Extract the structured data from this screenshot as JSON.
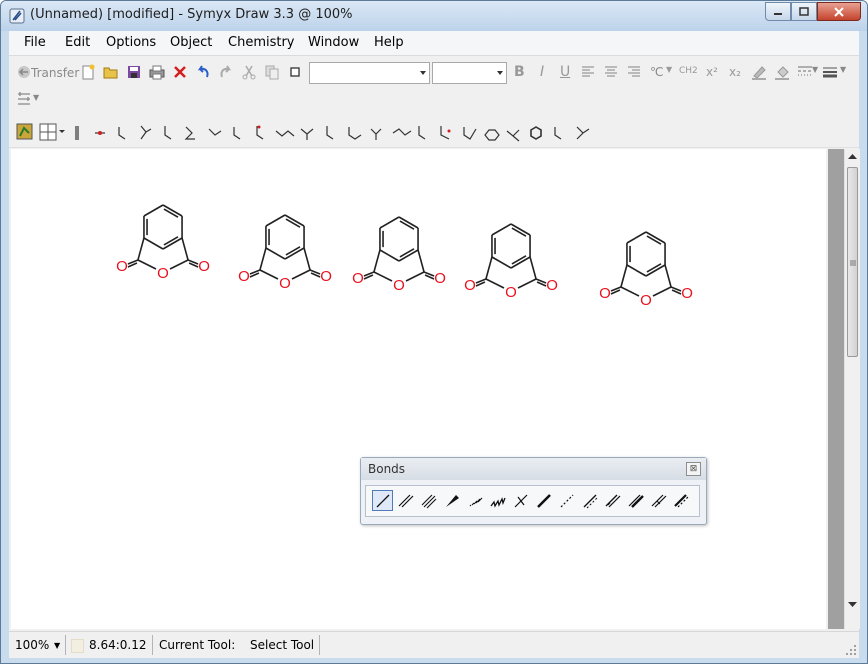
{
  "window": {
    "title": "(Unnamed) [modified] - Symyx Draw 3.3  @ 100%"
  },
  "menubar": {
    "items": [
      "File",
      "Edit",
      "Options",
      "Object",
      "Chemistry",
      "Window",
      "Help"
    ]
  },
  "toolbar": {
    "transfer_label": "Transfer",
    "font_combo_value": "",
    "size_combo_value": "",
    "bold_label": "B",
    "italic_label": "I",
    "underline_label": "U",
    "celsius_label": "℃",
    "ch2_label": "CH2",
    "superscript_label": "x²",
    "subscript_label": "x₂"
  },
  "molecules": [
    {
      "name": "phthalic-anhydride-1",
      "atoms": [
        "O",
        "O",
        "O"
      ]
    },
    {
      "name": "phthalic-anhydride-2",
      "atoms": [
        "O",
        "O",
        "O"
      ]
    },
    {
      "name": "phthalic-anhydride-3",
      "atoms": [
        "O",
        "O",
        "O"
      ]
    },
    {
      "name": "phthalic-anhydride-4",
      "atoms": [
        "O",
        "O",
        "O"
      ]
    },
    {
      "name": "phthalic-anhydride-5",
      "atoms": [
        "O",
        "O",
        "O"
      ]
    }
  ],
  "atom_color": "#e8121e",
  "bonds_palette": {
    "title": "Bonds",
    "close_glyph": "⊠",
    "tools": [
      "single-bond",
      "double-bond",
      "triple-bond",
      "wedge-bond",
      "hashed-wedge-bond",
      "wavy-bond",
      "crossed-bond",
      "bold-bond",
      "dashed-bond",
      "aromatic-bond",
      "double-dashed-bond",
      "bold-double-bond",
      "double-either-bond",
      "double-bold-dashed-bond"
    ]
  },
  "statusbar": {
    "zoom": "100%",
    "coords": "8.64:0.12",
    "current_tool_label": "Current Tool:",
    "current_tool_value": "Select Tool"
  }
}
